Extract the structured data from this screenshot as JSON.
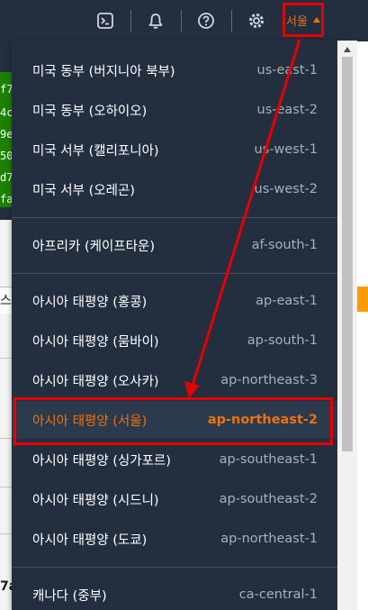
{
  "nav": {
    "icons": [
      "cloudshell-icon",
      "bell-icon",
      "help-icon",
      "gear-icon"
    ],
    "region_button": {
      "label": "서울",
      "caret": "caret-up-icon"
    }
  },
  "background_fragments": [
    "f7",
    "4c",
    "9e",
    "50",
    "d7",
    "fa",
    "스",
    "7a"
  ],
  "regions": [
    {
      "name": "미국 동부 (버지니아 북부)",
      "code": "us-east-1",
      "selected": false
    },
    {
      "name": "미국 동부 (오하이오)",
      "code": "us-east-2",
      "selected": false
    },
    {
      "name": "미국 서부 (캘리포니아)",
      "code": "us-west-1",
      "selected": false
    },
    {
      "name": "미국 서부 (오레곤)",
      "code": "us-west-2",
      "selected": false
    },
    {
      "name": "아프리카 (케이프타운)",
      "code": "af-south-1",
      "selected": false
    },
    {
      "name": "아시아 태평양 (홍콩)",
      "code": "ap-east-1",
      "selected": false
    },
    {
      "name": "아시아 태평양 (뭄바이)",
      "code": "ap-south-1",
      "selected": false
    },
    {
      "name": "아시아 태평양 (오사카)",
      "code": "ap-northeast-3",
      "selected": false
    },
    {
      "name": "아시아 태평양 (서울)",
      "code": "ap-northeast-2",
      "selected": true
    },
    {
      "name": "아시아 태평양 (싱가포르)",
      "code": "ap-southeast-1",
      "selected": false
    },
    {
      "name": "아시아 태평양 (시드니)",
      "code": "ap-southeast-2",
      "selected": false
    },
    {
      "name": "아시아 태평양 (도쿄)",
      "code": "ap-northeast-1",
      "selected": false
    },
    {
      "name": "캐나다 (중부)",
      "code": "ca-central-1",
      "selected": false
    }
  ],
  "colors": {
    "nav_bg": "#232f3e",
    "accent_orange": "#ec7211",
    "annotation_red": "#e60000"
  }
}
